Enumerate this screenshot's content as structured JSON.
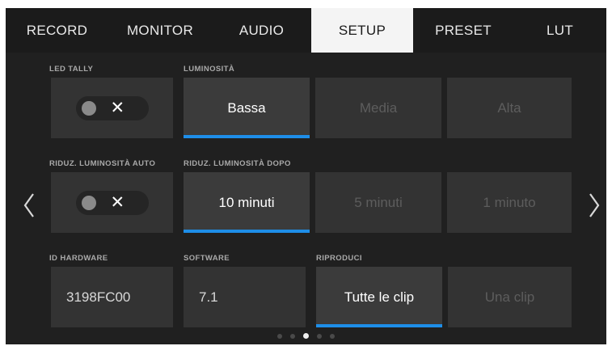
{
  "tabs": [
    {
      "label": "RECORD",
      "active": false
    },
    {
      "label": "MONITOR",
      "active": false
    },
    {
      "label": "AUDIO",
      "active": false
    },
    {
      "label": "SETUP",
      "active": true
    },
    {
      "label": "PRESET",
      "active": false
    },
    {
      "label": "LUT",
      "active": false
    }
  ],
  "led_tally": {
    "label": "LED TALLY",
    "state_symbol": "✕",
    "enabled": false
  },
  "luminosita": {
    "label": "LUMINOSITÀ",
    "options": [
      "Bassa",
      "Media",
      "Alta"
    ],
    "selected": "Bassa"
  },
  "auto_dim": {
    "label": "RIDUZ. LUMINOSITÀ AUTO",
    "state_symbol": "✕",
    "enabled": false
  },
  "dim_after": {
    "label": "RIDUZ. LUMINOSITÀ DOPO",
    "options": [
      "10 minuti",
      "5 minuti",
      "1 minuto"
    ],
    "selected": "10 minuti"
  },
  "hardware_id": {
    "label": "ID HARDWARE",
    "value": "3198FC00"
  },
  "software": {
    "label": "SOFTWARE",
    "value": "7.1"
  },
  "playback": {
    "label": "RIPRODUCI",
    "options": [
      "Tutte le clip",
      "Una clip"
    ],
    "selected": "Tutte le clip"
  },
  "pagination": {
    "pages": 5,
    "current": 3
  },
  "colors": {
    "accent": "#1e8ee8",
    "background": "#202020",
    "cell": "#333333"
  }
}
